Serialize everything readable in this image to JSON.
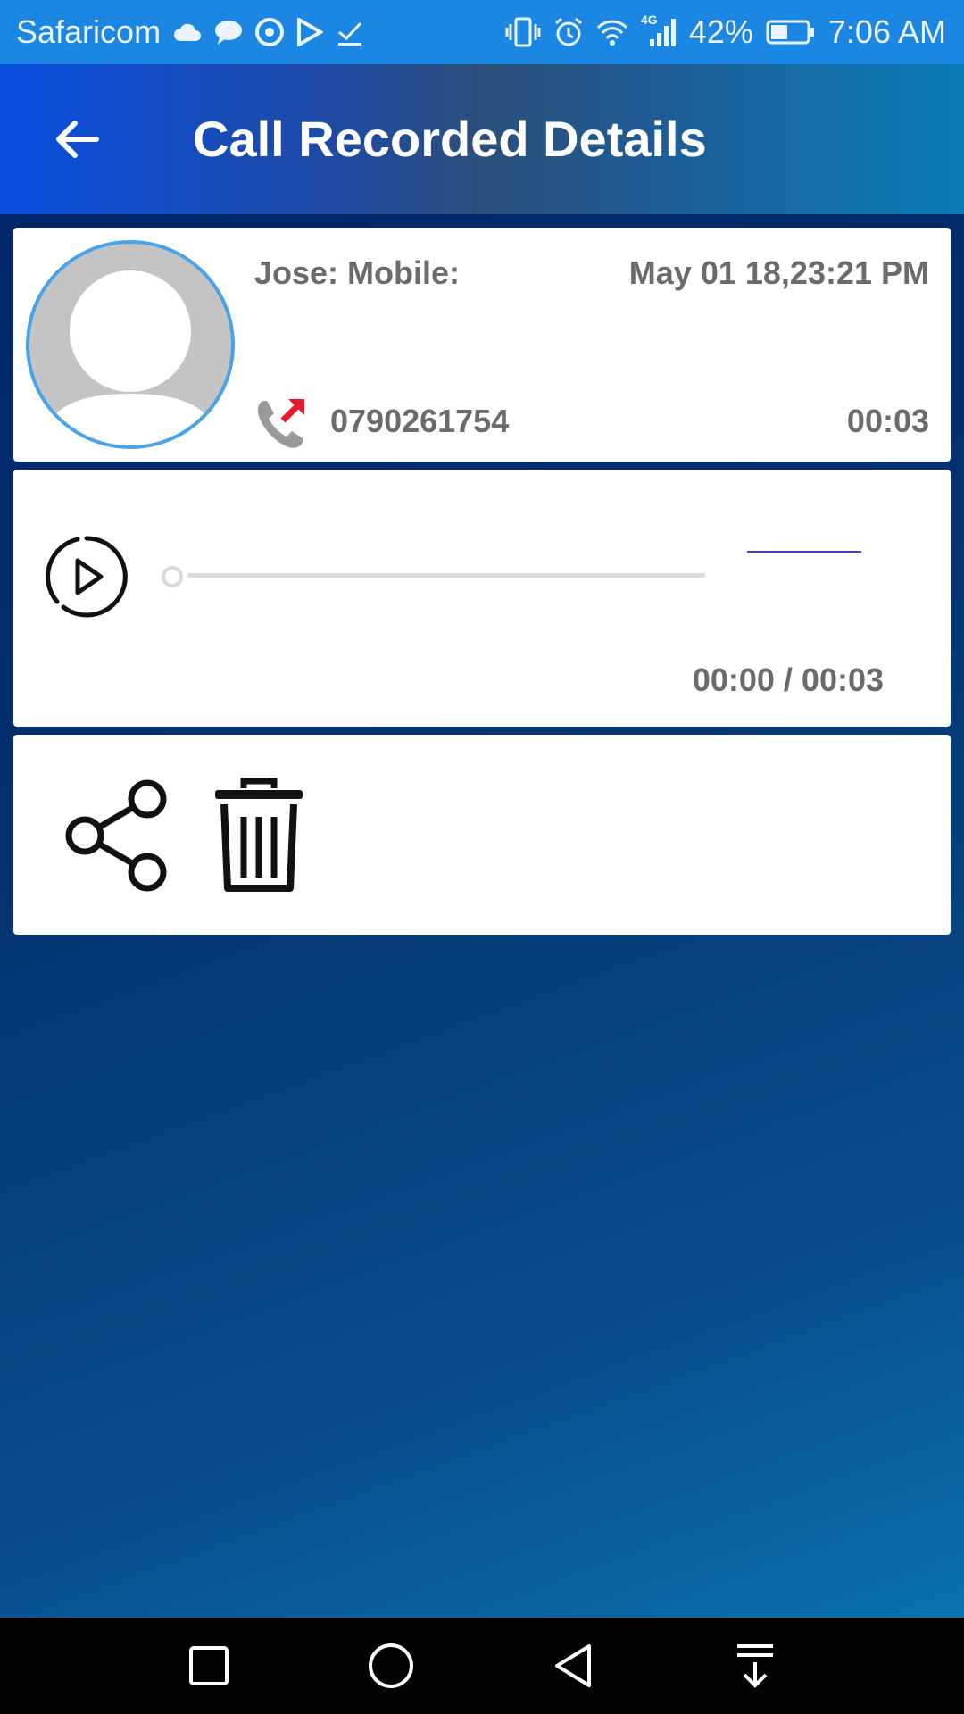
{
  "status_bar": {
    "carrier": "Safaricom",
    "network_type": "4G",
    "battery": "42%",
    "time": "7:06 AM"
  },
  "app_bar": {
    "title": "Call Recorded Details"
  },
  "call": {
    "contact": "Jose: Mobile:",
    "datetime": "May 01 18,23:21 PM",
    "number": "0790261754",
    "duration": "00:03",
    "direction": "outgoing"
  },
  "player": {
    "time_display": "00:00 / 00:03",
    "progress": 0
  },
  "colors": {
    "status_bar": "#1c86e3",
    "avatar_border": "#4aa3e8",
    "outgoing_arrow": "#e8192c",
    "text_grey": "#6b6b6b"
  }
}
